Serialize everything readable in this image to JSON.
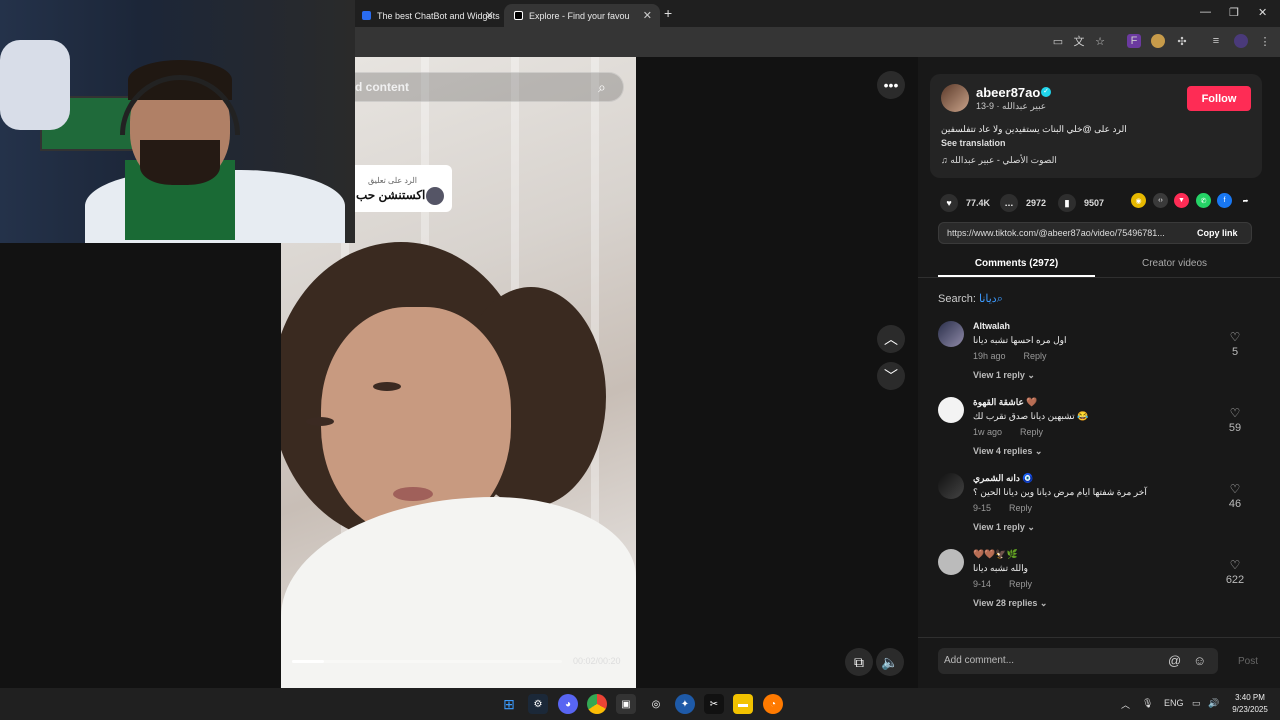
{
  "browser": {
    "tabs": [
      {
        "title": "The best ChatBot and Widgets",
        "active": false
      },
      {
        "title": "Explore - Find your favourite",
        "active": true
      }
    ]
  },
  "search": {
    "placeholder": "d content"
  },
  "video": {
    "reply_label": "الرد على تعليق",
    "reply_text": "اكستنشن حب",
    "progress_percent": 12,
    "timecode": "00:02/00:20"
  },
  "author": {
    "username": "abeer87ao",
    "subline": "عبير عبدالله · 9-13",
    "follow_label": "Follow",
    "caption": "الرد على @خلي البنات يستفيدين ولا عاد تتفلسفين",
    "see_translation": "See translation",
    "music": "الصوت الأصلي - عبير عبدالله"
  },
  "stats": {
    "likes": "77.4K",
    "comments": "2972",
    "saves": "9507"
  },
  "share": {
    "url": "https://www.tiktok.com/@abeer87ao/video/75496781...",
    "copy_label": "Copy link"
  },
  "panel_tabs": {
    "comments": "Comments (2972)",
    "creator": "Creator videos"
  },
  "comment_search": {
    "label": "Search:",
    "term": "ديانا"
  },
  "comments": [
    {
      "name": "Altwalah",
      "text": "اول مره احسها تشبه ديانا",
      "time": "19h ago",
      "reply": "Reply",
      "view": "View 1 reply",
      "likes": "5"
    },
    {
      "name": "عاشقة القهوة 🤎",
      "text": "تشبهين ديانا صدق تقرب لك 😂",
      "time": "1w ago",
      "reply": "Reply",
      "view": "View 4 replies",
      "likes": "59"
    },
    {
      "name": "دانه الشمري 🧿",
      "text": "آخر مرة شفتها ايام مرض ديانا وين ديانا الحين ؟",
      "time": "9-15",
      "reply": "Reply",
      "view": "View 1 reply",
      "likes": "46"
    },
    {
      "name": "🤎🤎🦅🌿",
      "text": "والله تشبه ديانا",
      "time": "9-14",
      "reply": "Reply",
      "view": "View 28 replies",
      "likes": "622"
    }
  ],
  "comment_box": {
    "placeholder": "Add comment...",
    "post_label": "Post"
  },
  "taskbar": {
    "lang": "ENG",
    "time": "3:40 PM",
    "date": "9/23/2025"
  },
  "colors": {
    "follow": "#fe2c55",
    "verified": "#20d5ec",
    "panel": "#181818"
  }
}
